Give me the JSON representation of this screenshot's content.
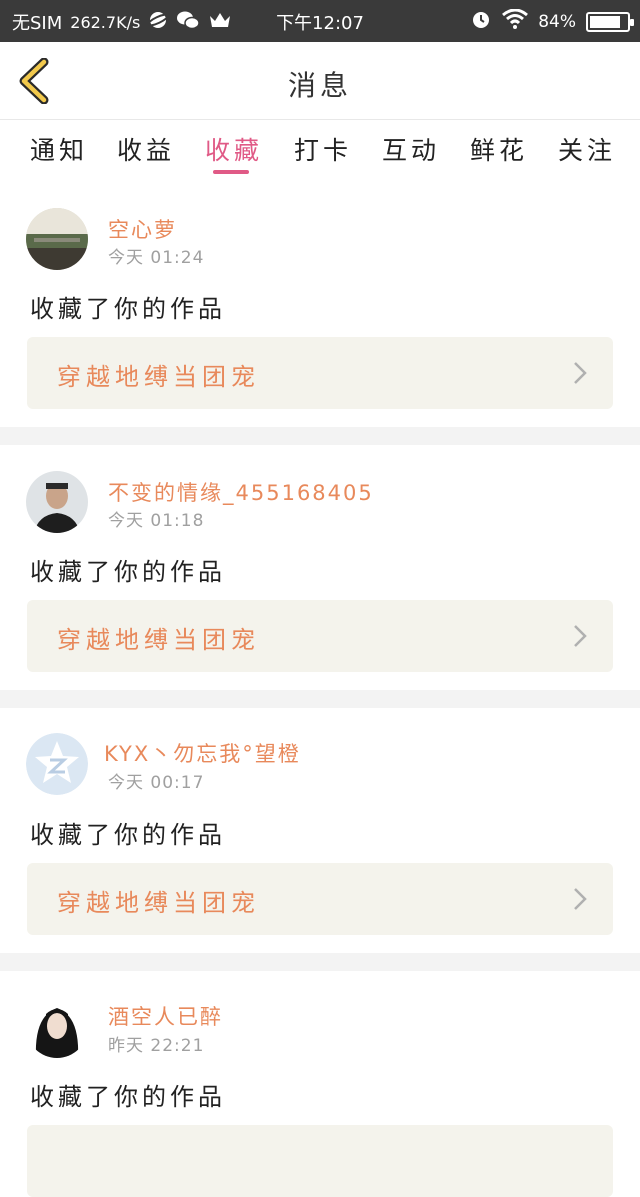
{
  "status_bar": {
    "carrier": "无SIM",
    "speed": "262.7K/s",
    "time": "下午12:07",
    "battery": "84%",
    "battery_level": 0.84
  },
  "header": {
    "title": "消息"
  },
  "tabs": [
    {
      "label": "通知"
    },
    {
      "label": "收益"
    },
    {
      "label": "收藏",
      "active": true
    },
    {
      "label": "打卡"
    },
    {
      "label": "互动"
    },
    {
      "label": "鲜花"
    },
    {
      "label": "关注"
    }
  ],
  "messages": [
    {
      "user": "空心萝",
      "time": "今天 01:24",
      "action": "收藏了你的作品",
      "work": "穿越地缚当团宠",
      "avatar": "avatar-scenery-icon"
    },
    {
      "user": "不变的情缘_455168405",
      "time": "今天 01:18",
      "action": "收藏了你的作品",
      "work": "穿越地缚当团宠",
      "avatar": "avatar-man-icon"
    },
    {
      "user": "KYX丶勿忘我°望橙",
      "time": "今天 00:17",
      "action": "收藏了你的作品",
      "work": "穿越地缚当团宠",
      "avatar": "avatar-default-z-icon"
    },
    {
      "user": "酒空人已醉",
      "time": "昨天 22:21",
      "action": "收藏了你的作品",
      "work": "",
      "avatar": "avatar-woman-icon"
    }
  ],
  "colors": {
    "accent": "#e05a86",
    "username": "#e8895b",
    "work_box_bg": "#f4f3ec",
    "status_bar_bg": "#3a3a3a"
  }
}
